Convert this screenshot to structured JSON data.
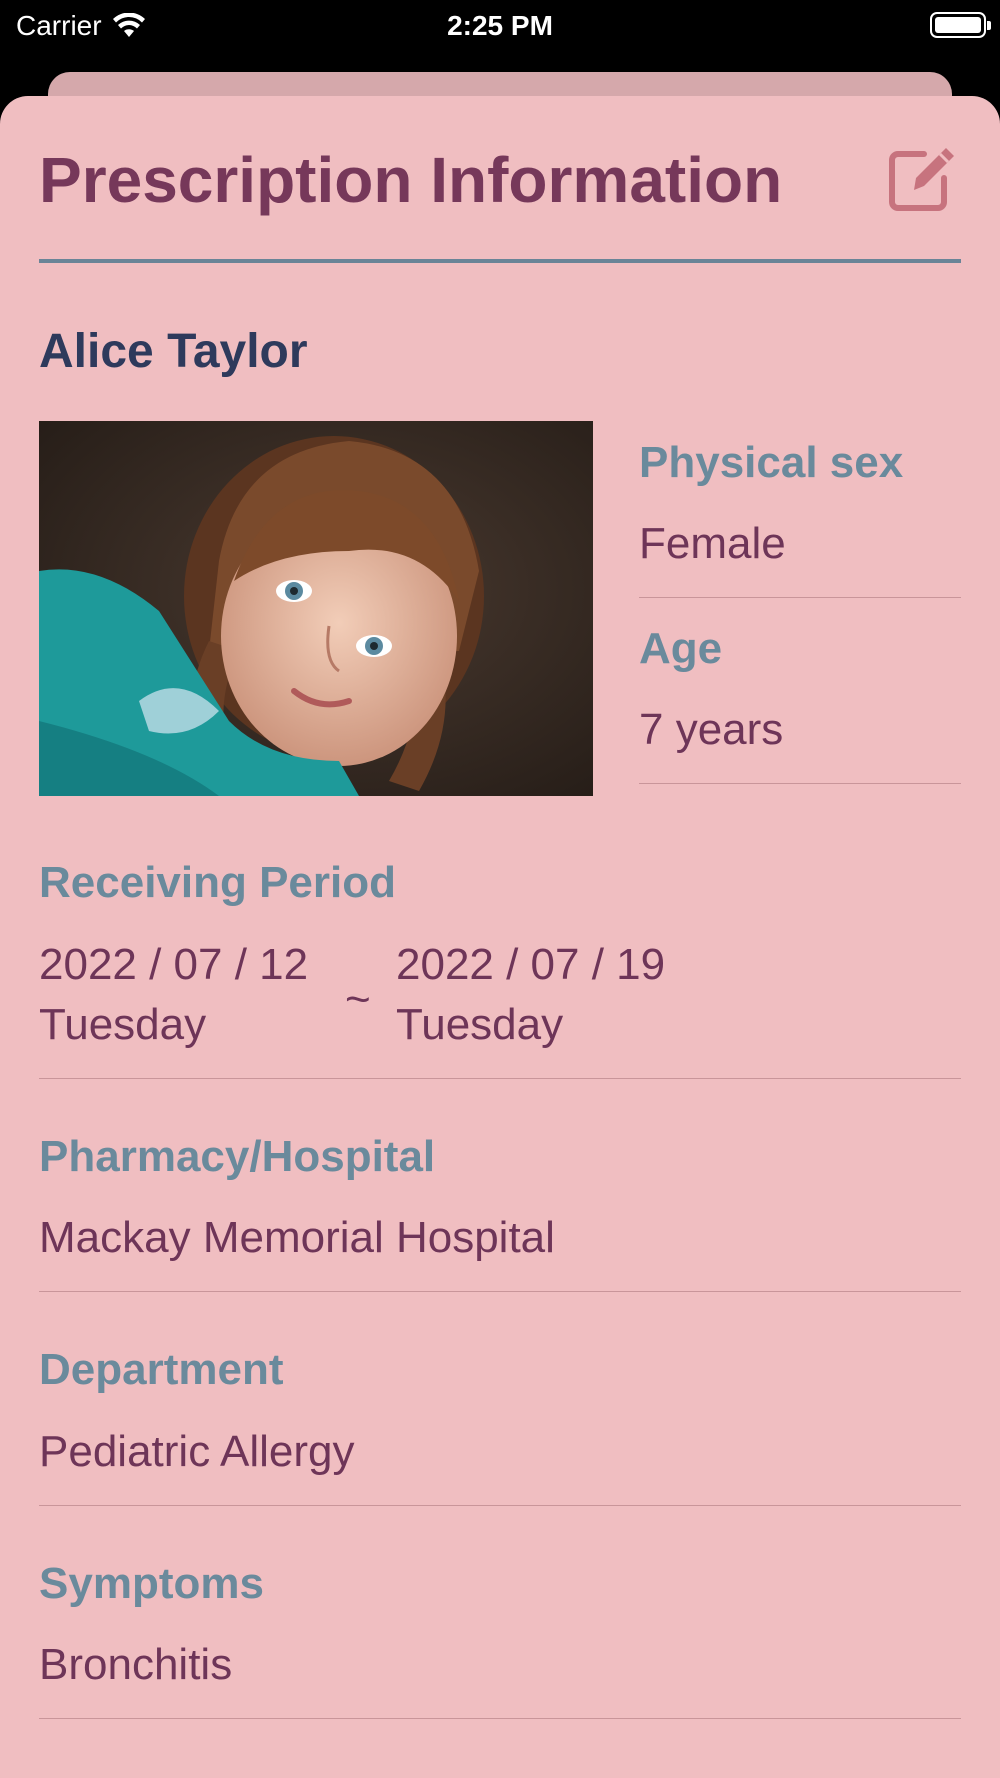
{
  "status_bar": {
    "carrier": "Carrier",
    "time": "2:25 PM"
  },
  "header": {
    "title": "Prescription Information",
    "edit_icon": "square-pencil-icon"
  },
  "patient": {
    "name": "Alice Taylor",
    "photo_description_icon": "patient-photo",
    "physical_sex_label": "Physical sex",
    "physical_sex": "Female",
    "age_label": "Age",
    "age": "7 years"
  },
  "receiving_period": {
    "label": "Receiving Period",
    "start_date": "2022 / 07 / 12",
    "start_day": "Tuesday",
    "separator": "~",
    "end_date": "2022 / 07 / 19",
    "end_day": "Tuesday"
  },
  "pharmacy": {
    "label": "Pharmacy/Hospital",
    "value": "Mackay Memorial Hospital"
  },
  "department": {
    "label": "Department",
    "value": "Pediatric Allergy"
  },
  "symptoms": {
    "label": "Symptoms",
    "value": "Bronchitis"
  },
  "colors": {
    "sheet_background": "#f0bec1",
    "title": "#76385a",
    "label": "#6a8a9c",
    "value": "#6e3558",
    "name": "#2e3a5c",
    "divider": "#6a8497"
  }
}
